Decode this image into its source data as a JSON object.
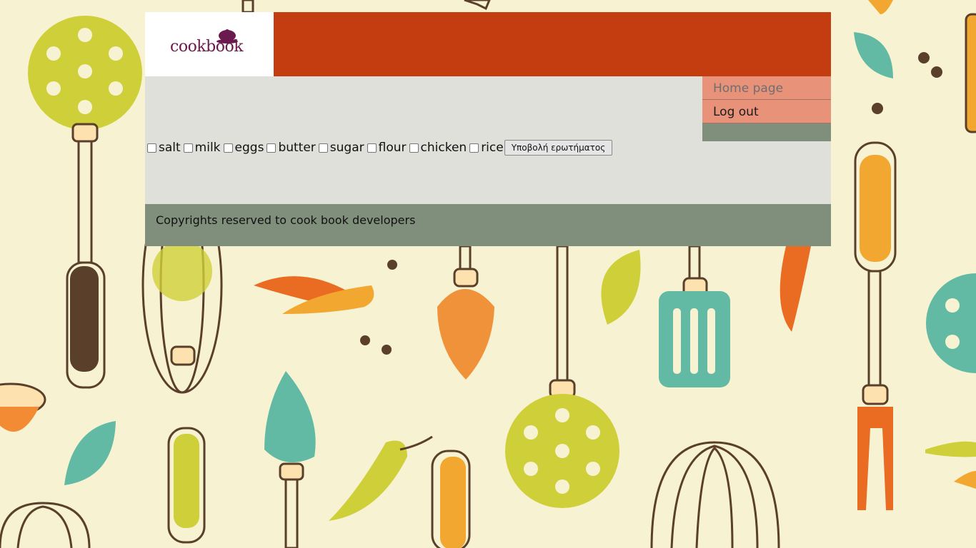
{
  "logo": {
    "text": "cookbook"
  },
  "nav": {
    "items": [
      {
        "label": "Home page"
      },
      {
        "label": "Log out"
      }
    ]
  },
  "form": {
    "ingredients": [
      {
        "label": "salt"
      },
      {
        "label": "milk"
      },
      {
        "label": "eggs"
      },
      {
        "label": "butter"
      },
      {
        "label": "sugar"
      },
      {
        "label": "flour"
      },
      {
        "label": "chicken"
      },
      {
        "label": "rice"
      }
    ],
    "submit_label": "Υποβολή ερωτήματος"
  },
  "footer": {
    "text": "Copyrights reserved to cook book developers"
  },
  "colors": {
    "background": "#f7f3d2",
    "header": "#c43d10",
    "content": "#dfe0da",
    "nav": "#e8927a",
    "footer": "#808f7c",
    "logo": "#6b1a4d"
  }
}
